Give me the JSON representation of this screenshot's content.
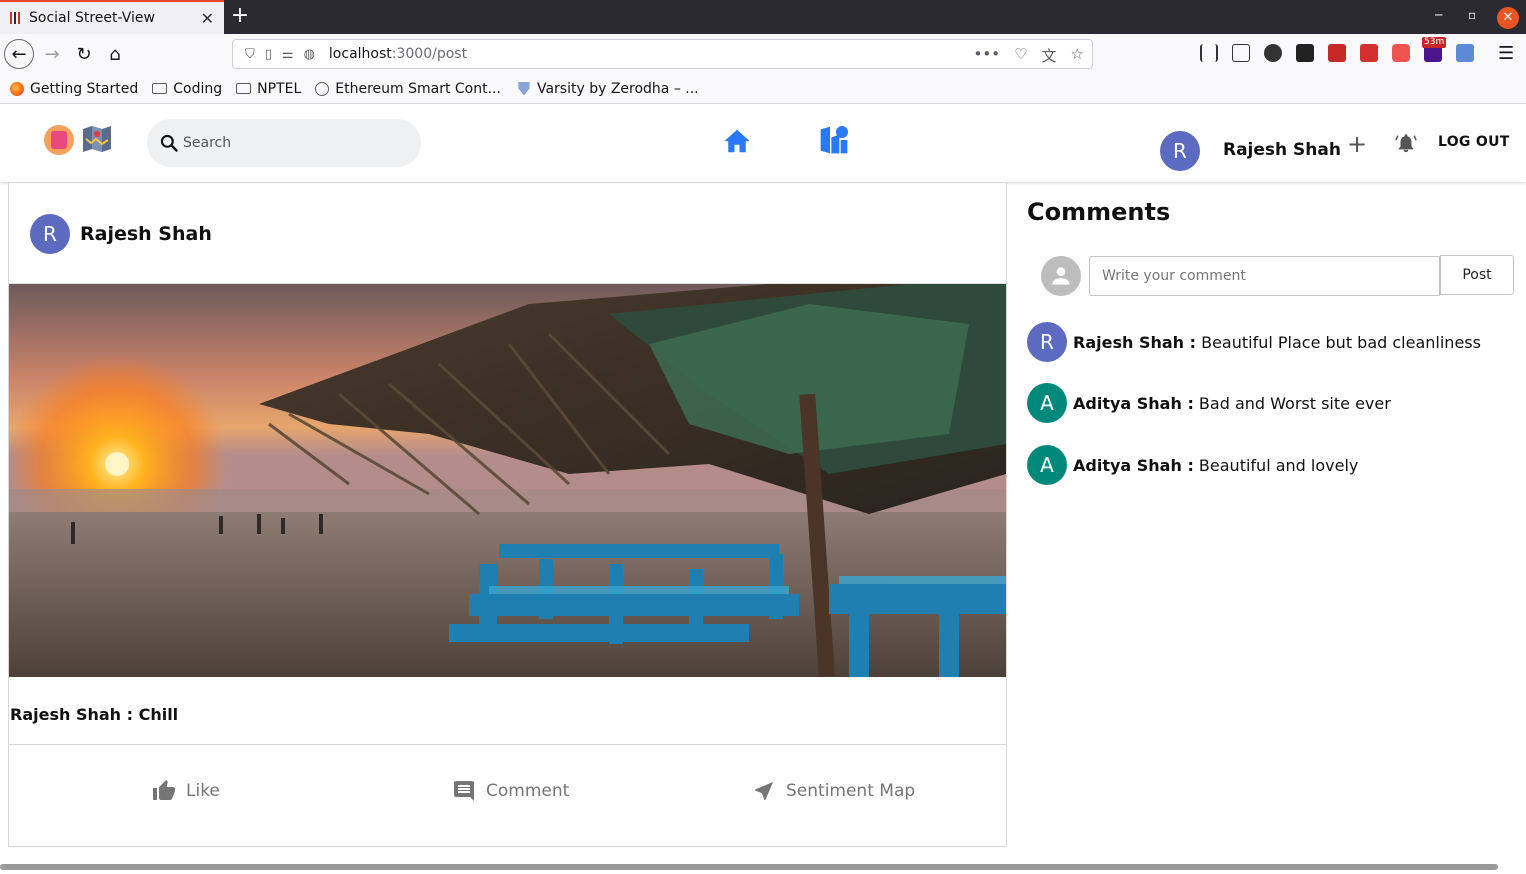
{
  "browser": {
    "tab_title": "Social Street-View",
    "url_host": "localhost",
    "url_path": ":3000/post",
    "badge": "53m",
    "bookmarks": [
      {
        "label": "Getting Started"
      },
      {
        "label": "Coding"
      },
      {
        "label": "NPTEL"
      },
      {
        "label": "Ethereum Smart Cont..."
      },
      {
        "label": "Varsity by Zerodha – ..."
      }
    ]
  },
  "header": {
    "search_placeholder": "Search",
    "user_initial": "R",
    "user_name": "Rajesh Shah",
    "logout_label": "LOG OUT",
    "accent_color": "#2979ff",
    "avatar_color": "#5c6bc0"
  },
  "post": {
    "author_initial": "R",
    "author": "Rajesh Shah",
    "caption": "Rajesh Shah : Chill",
    "actions": {
      "like": "Like",
      "comment": "Comment",
      "sentiment": "Sentiment Map"
    }
  },
  "comments": {
    "title": "Comments",
    "input_placeholder": "Write your comment",
    "post_label": "Post",
    "items": [
      {
        "initial": "R",
        "name": "Rajesh Shah :",
        "text": " Beautiful Place but bad cleanliness",
        "color": "#5c6bc0"
      },
      {
        "initial": "A",
        "name": "Aditya Shah :",
        "text": " Bad and Worst site ever",
        "color": "#00897b"
      },
      {
        "initial": "A",
        "name": "Aditya Shah :",
        "text": " Beautiful and lovely",
        "color": "#00897b"
      }
    ]
  }
}
